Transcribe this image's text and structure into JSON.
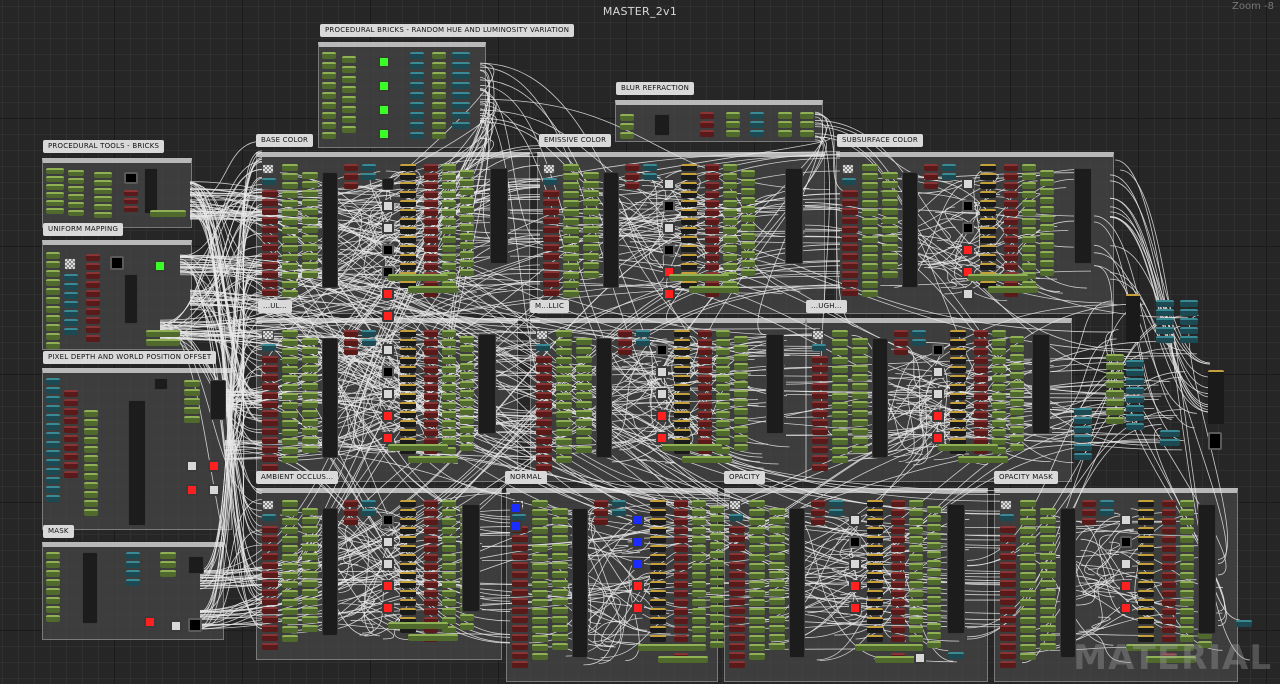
{
  "editor": {
    "title": "MASTER_2v1",
    "zoom": "Zoom -8",
    "watermark": "MATERIAL"
  },
  "comments": [
    {
      "id": "procedural-bricks",
      "label": "PROCEDURAL BRICKS - RANDOM HUE AND LUMINOSITY VARIATION"
    },
    {
      "id": "blur-refraction",
      "label": "BLUR REFRACTION"
    },
    {
      "id": "procedural-tools",
      "label": "PROCEDURAL TOOLS - BRICKS"
    },
    {
      "id": "base-color",
      "label": "BASE COLOR"
    },
    {
      "id": "emissive-color",
      "label": "EMISSIVE COLOR"
    },
    {
      "id": "subsurface-color",
      "label": "SUBSURFACE COLOR"
    },
    {
      "id": "uniform-mapping",
      "label": "UNIFORM MAPPING"
    },
    {
      "id": "pixel-depth",
      "label": "PIXEL DEPTH AND WORLD POSITION OFFSET"
    },
    {
      "id": "mask",
      "label": "MASK"
    },
    {
      "id": "ambient-occlusion",
      "label": "AMBIENT OCCLUS..."
    },
    {
      "id": "normal",
      "label": "NORMAL"
    },
    {
      "id": "opacity",
      "label": "OPACITY"
    },
    {
      "id": "opacity-mask",
      "label": "OPACITY MASK"
    },
    {
      "id": "metallic",
      "label": "M...LLIC"
    },
    {
      "id": "roughness",
      "label": "...UGH..."
    },
    {
      "id": "specular",
      "label": "...UL..."
    }
  ],
  "colors": {
    "param_node": "#4f6a2c",
    "math_node": "#5a1a1a",
    "texture_node": "#1d4a52",
    "wire": "#e8e8e8",
    "comment_header": "#b9b9b9"
  }
}
